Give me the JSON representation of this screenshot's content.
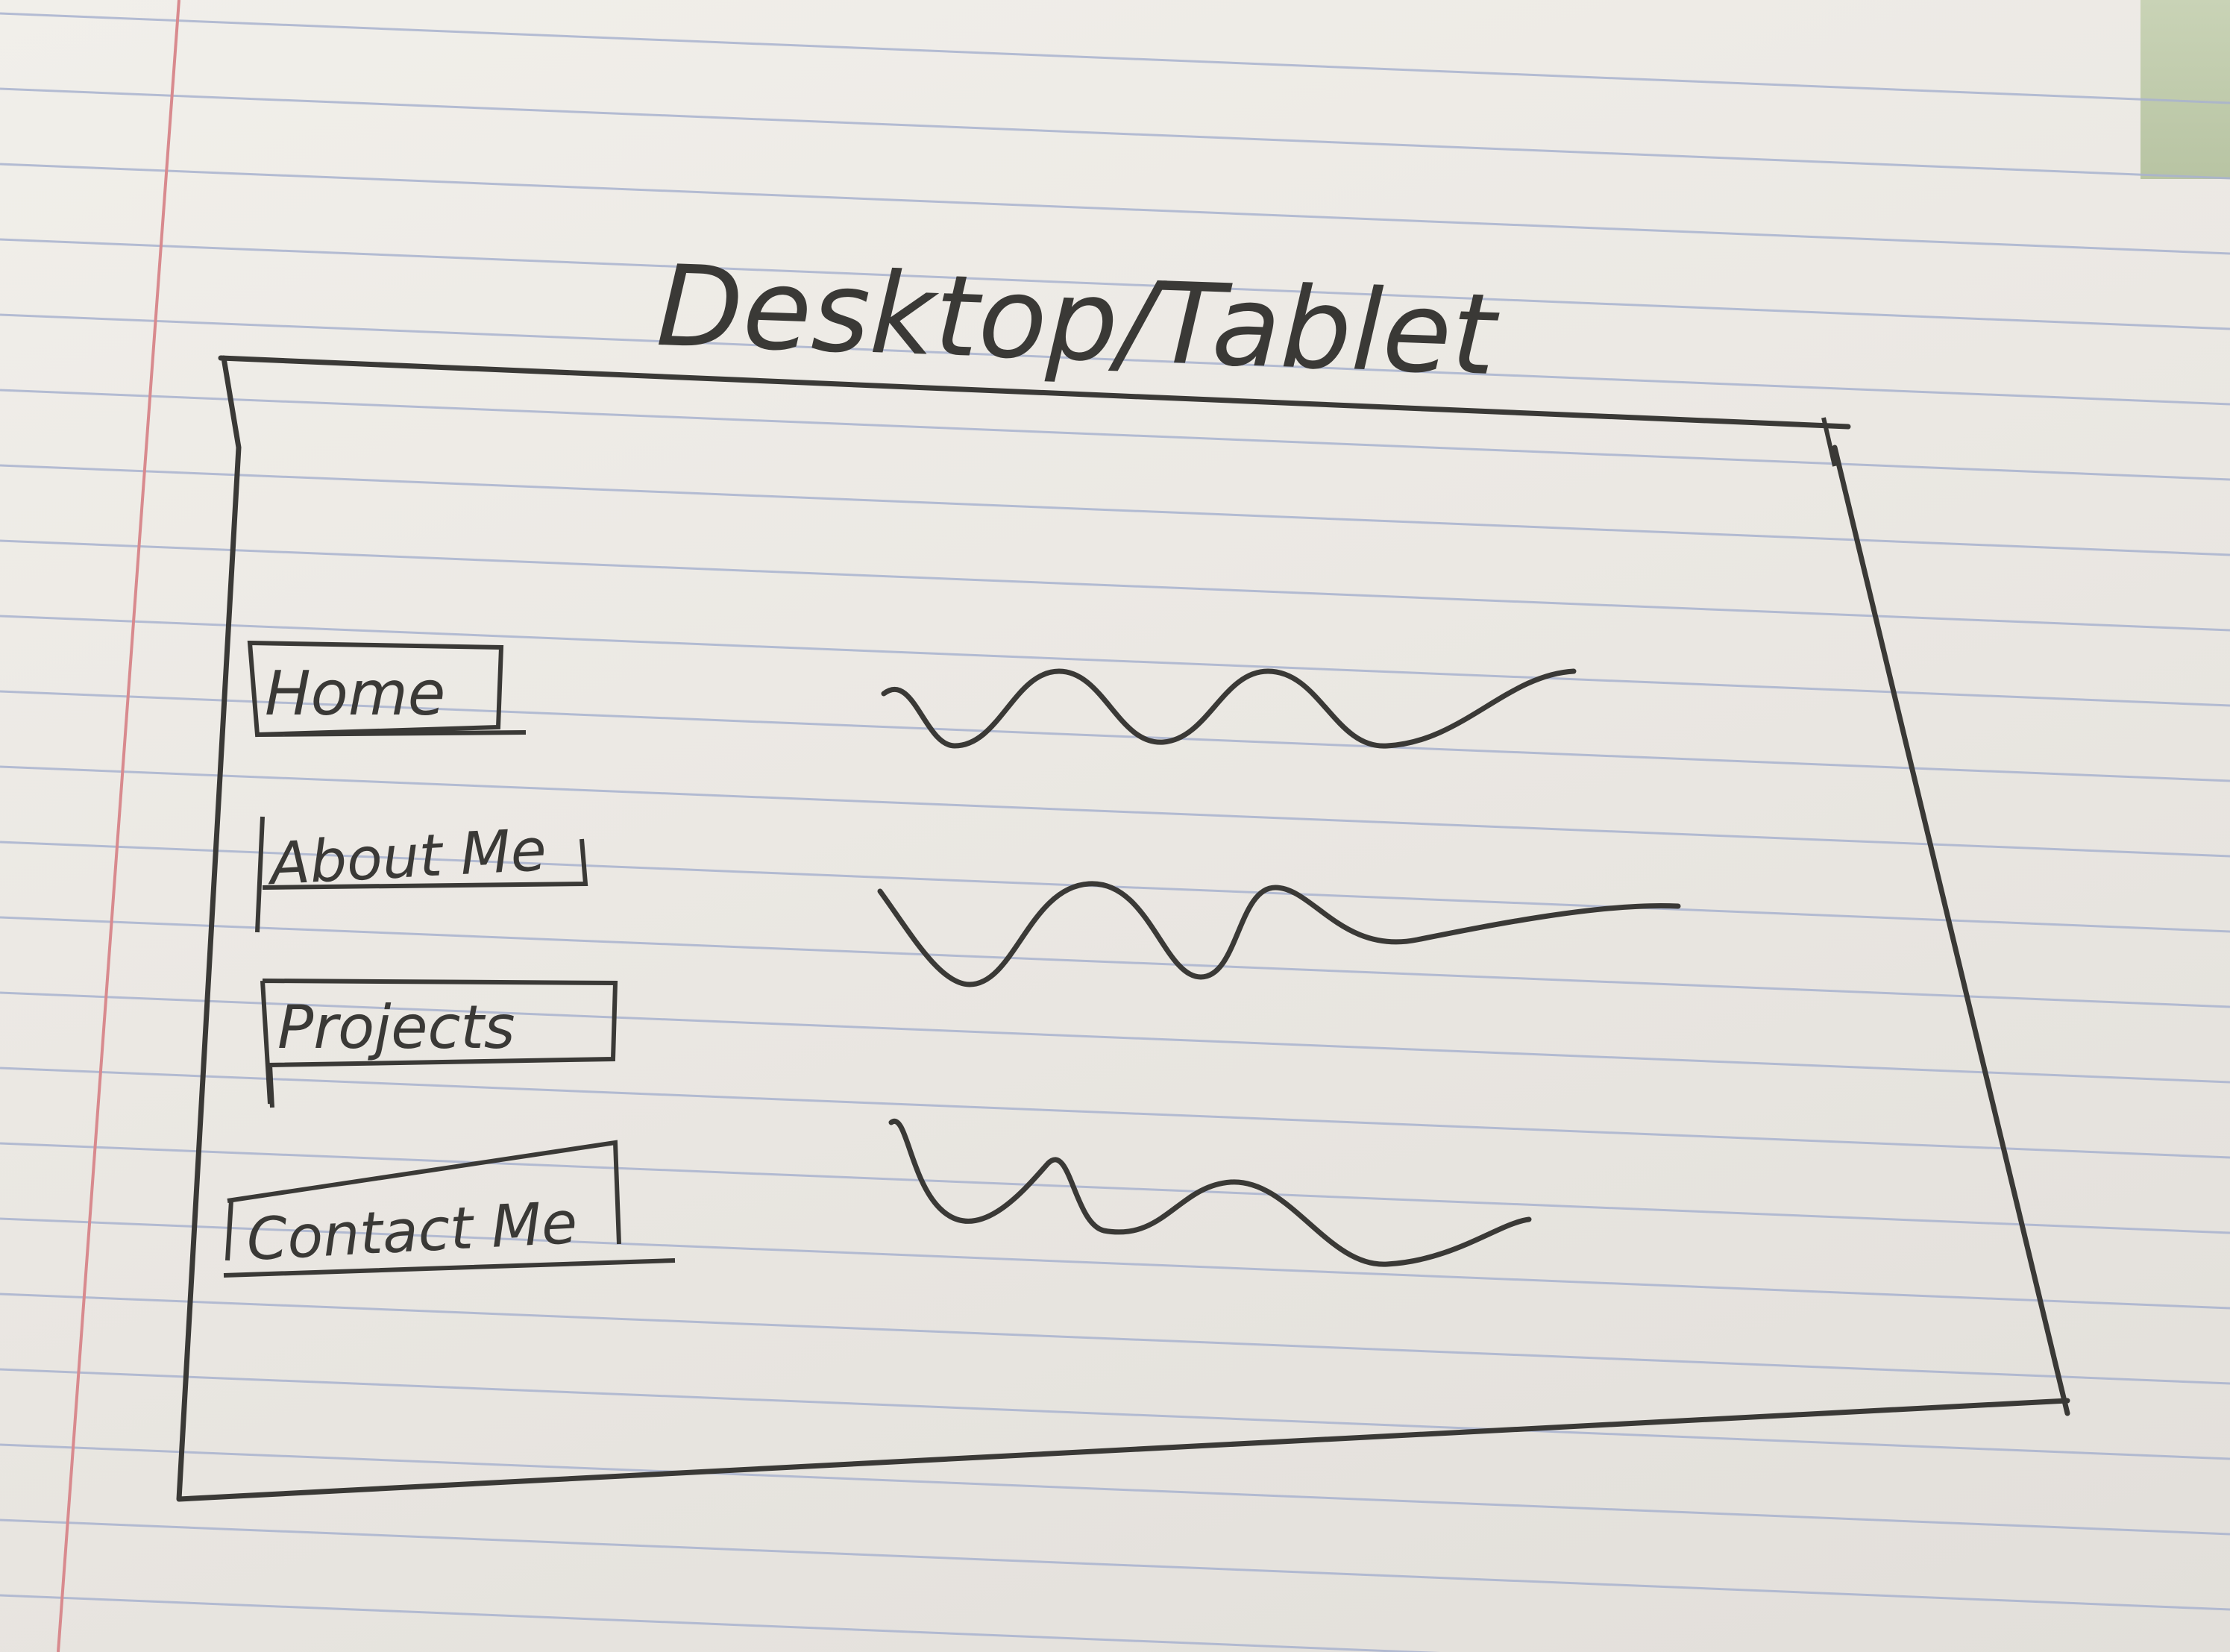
{
  "title": "Desktop/Tablet",
  "nav": {
    "items": [
      {
        "label": "Home"
      },
      {
        "label": "About Me"
      },
      {
        "label": "Projects"
      },
      {
        "label": "Contact Me"
      }
    ]
  },
  "colors": {
    "paper": "#ebe8e3",
    "rule_line": "#a9b3cf",
    "margin_line": "#d88a8e",
    "pencil": "#3a3936"
  }
}
